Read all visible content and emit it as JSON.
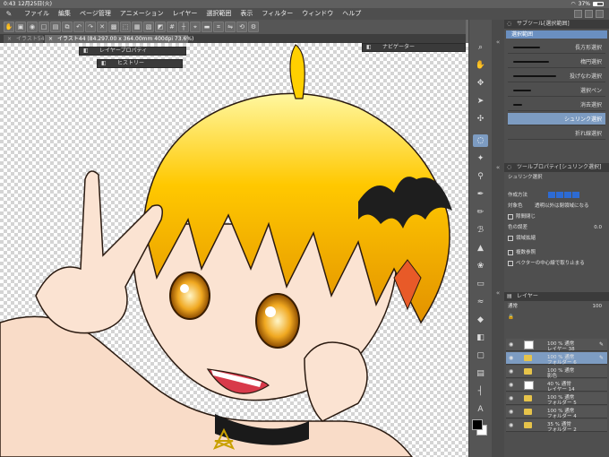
{
  "status_bar": {
    "time": "0:43",
    "date": "12月25日(火)",
    "battery": "37%",
    "battery_level": 0.37
  },
  "menu": {
    "items": [
      "ファイル",
      "編集",
      "ページ管理",
      "アニメーション",
      "レイヤー",
      "選択範囲",
      "表示",
      "フィルター",
      "ウィンドウ",
      "ヘルプ"
    ]
  },
  "tabs": {
    "inactive": "イラスト54(I...",
    "active": "イラスト44 (84.297.00 x 364.00mm 400dpi 73.6%)"
  },
  "floating_palettes": {
    "layer_property": "レイヤープロパティ",
    "history": "ヒストリー",
    "navigator": "ナビゲーター"
  },
  "subtool_panel": {
    "header": "サブツール[選択範囲]",
    "tab": "選択範囲",
    "items": [
      {
        "label": "長方形選択"
      },
      {
        "label": "楕円選択"
      },
      {
        "label": "投げなわ選択"
      },
      {
        "label": "選択ペン"
      },
      {
        "label": "消去選択"
      },
      {
        "label": "シュリンク選択",
        "selected": true
      },
      {
        "label": "折れ線選択"
      }
    ]
  },
  "tool_property": {
    "header": "ツールプロパティ[シュリンク選択]",
    "title": "シュリンク選択",
    "rows": {
      "mode": "作成方法",
      "target_color": "対象色",
      "target_color_value": "透明以外は閉領域になる",
      "close_gap": "隙間閉じ",
      "color_error": "色の誤差",
      "color_error_value": "0.0",
      "area_expand": "領域拡縮",
      "multi_ref": "複数参照",
      "vector_center": "ベクターの中心線で取り止まる"
    }
  },
  "layer_panel": {
    "header": "レイヤー",
    "blend_mode": "通常",
    "opacity": "100",
    "layers": [
      {
        "mode": "100 % 通常",
        "name": "レイヤー 38",
        "type": "raster"
      },
      {
        "mode": "100 % 通常",
        "name": "フォルダー 6",
        "type": "folder",
        "selected": true
      },
      {
        "mode": "100 % 通常",
        "name": "影色",
        "type": "folder"
      },
      {
        "mode": "40 % 通常",
        "name": "レイヤー 14",
        "type": "raster"
      },
      {
        "mode": "100 % 通常",
        "name": "フォルダー 5",
        "type": "folder"
      },
      {
        "mode": "100 % 通常",
        "name": "フォルダー 4",
        "type": "folder"
      },
      {
        "mode": "35 % 通常",
        "name": "フォルダー 2",
        "type": "folder"
      }
    ]
  },
  "colors": {
    "main": "#000000",
    "sub": "#ffffff",
    "accent": "#7d9cc2"
  }
}
